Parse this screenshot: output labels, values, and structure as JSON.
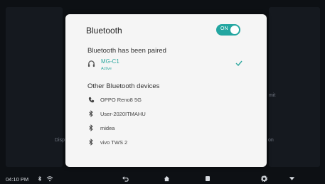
{
  "dialog": {
    "title": "Bluetooth",
    "toggle_label": "ON",
    "paired_section": "Bluetooth has been paired",
    "paired_device": {
      "name": "MG-C1",
      "status": "Active"
    },
    "other_section": "Other Bluetooth devices",
    "other_devices": [
      {
        "name": "OPPO Reno8 5G",
        "icon": "phone-icon"
      },
      {
        "name": "User-2020ITMAHU",
        "icon": "bluetooth-icon"
      },
      {
        "name": "midea",
        "icon": "bluetooth-icon"
      },
      {
        "name": "vivo TWS 2",
        "icon": "bluetooth-icon"
      }
    ]
  },
  "background": {
    "text_left": "Disp",
    "text_right_top": "mit",
    "text_right_bottom": "on"
  },
  "statusbar": {
    "time": "04:10 PM"
  },
  "colors": {
    "accent": "#23a6a1",
    "dialog_bg": "#f5f5f5",
    "background": "#0d1014"
  }
}
